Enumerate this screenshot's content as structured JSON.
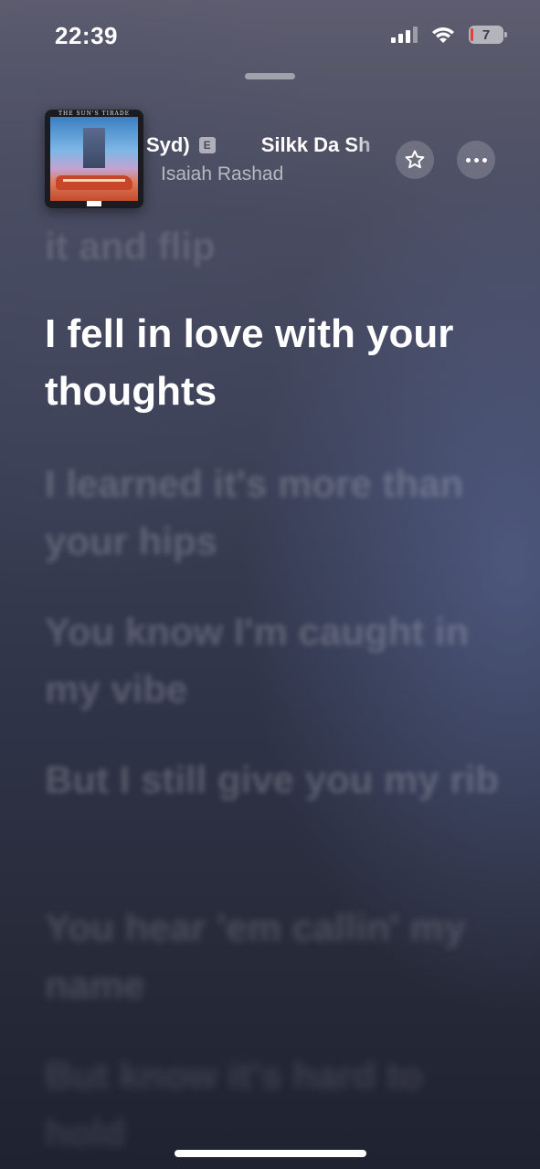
{
  "status_bar": {
    "time": "22:39",
    "battery_level": "7"
  },
  "now_playing": {
    "album_art_title": "THE SUN'S TIRADE",
    "title_visible": "Syd)",
    "explicit_badge": "E",
    "title_repeat_visible": "Silkk Da Sh",
    "artist": "Isaiah Rashad"
  },
  "icons": {
    "star": "star-icon",
    "more": "more-icon"
  },
  "lyrics": {
    "previous": "it and flip",
    "current": "I fell in love with your thoughts",
    "upcoming": [
      "I learned it's more than your hips",
      "You know I'm caught in my vibe",
      "But I still give you my rib",
      "You hear 'em callin' my name",
      "But know it's hard to hold"
    ]
  },
  "colors": {
    "background_top": "#5e5d70",
    "background_bottom": "#1f2230",
    "battery_low": "#e0413b"
  }
}
